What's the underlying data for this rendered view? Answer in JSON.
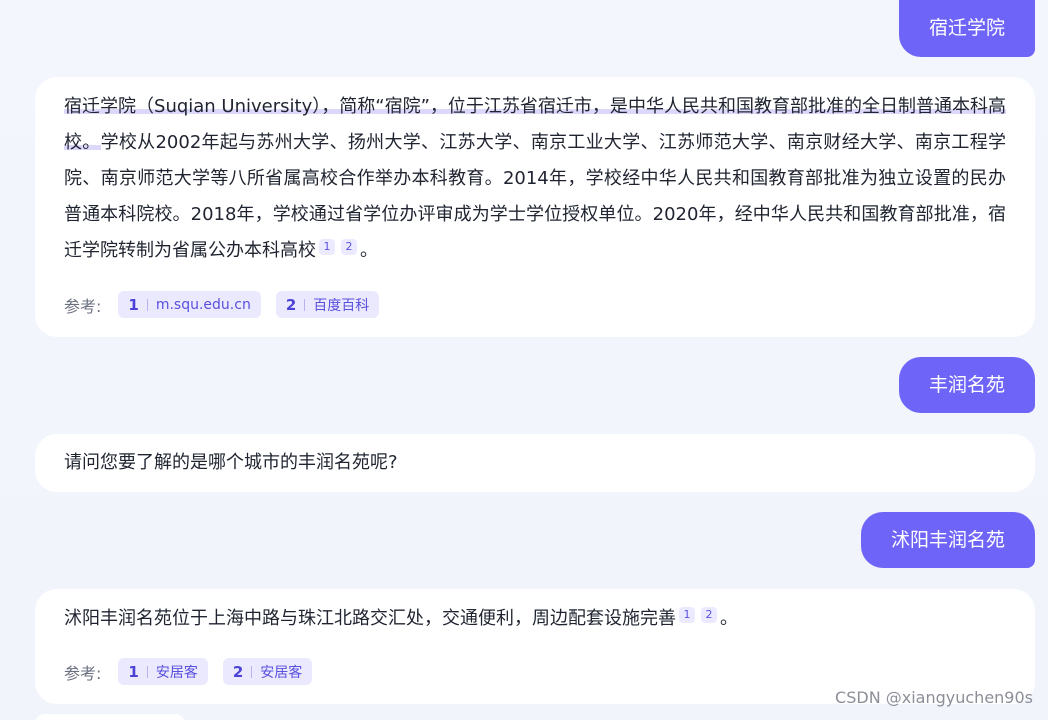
{
  "messages": {
    "user_1": "宿迁学院",
    "bot_1": {
      "highlight": "宿迁学院（Suqian University），简称“宿院”，位于江苏省宿迁市，是中华人民共和国教育部批准的全日制普通本科高校。",
      "text": "学校从2002年起与苏州大学、扬州大学、江苏大学、南京工业大学、江苏师范大学、南京财经大学、南京工程学院、南京师范大学等八所省属高校合作举办本科教育。2014年，学校经中华人民共和国教育部批准为独立设置的民办普通本科院校。2018年，学校通过省学位办评审成为学士学位授权单位。2020年，经中华人民共和国教育部批准，宿迁学院转制为省属公办本科高校",
      "cite_1": "1",
      "cite_2": "2",
      "end": "。",
      "refs_label": "参考:",
      "refs": [
        {
          "num": "1",
          "label": "m.squ.edu.cn"
        },
        {
          "num": "2",
          "label": "百度百科"
        }
      ]
    },
    "user_2": "丰润名苑",
    "bot_2": {
      "text": "请问您要了解的是哪个城市的丰润名苑呢?"
    },
    "user_3": "沭阳丰润名苑",
    "bot_3": {
      "text": "沭阳丰润名苑位于上海中路与珠江北路交汇处，交通便利，周边配套设施完善",
      "cite_1": "1",
      "cite_2": "2",
      "end": "。",
      "refs_label": "参考:",
      "refs": [
        {
          "num": "1",
          "label": "安居客"
        },
        {
          "num": "2",
          "label": "安居客"
        }
      ]
    }
  },
  "watermark": "CSDN @xiangyuchen90s",
  "colors": {
    "accent": "#6f64f8",
    "background": "#f2f5fc",
    "card": "#ffffff",
    "chip_bg": "#ebe9fd",
    "chip_text": "#5a50de"
  }
}
